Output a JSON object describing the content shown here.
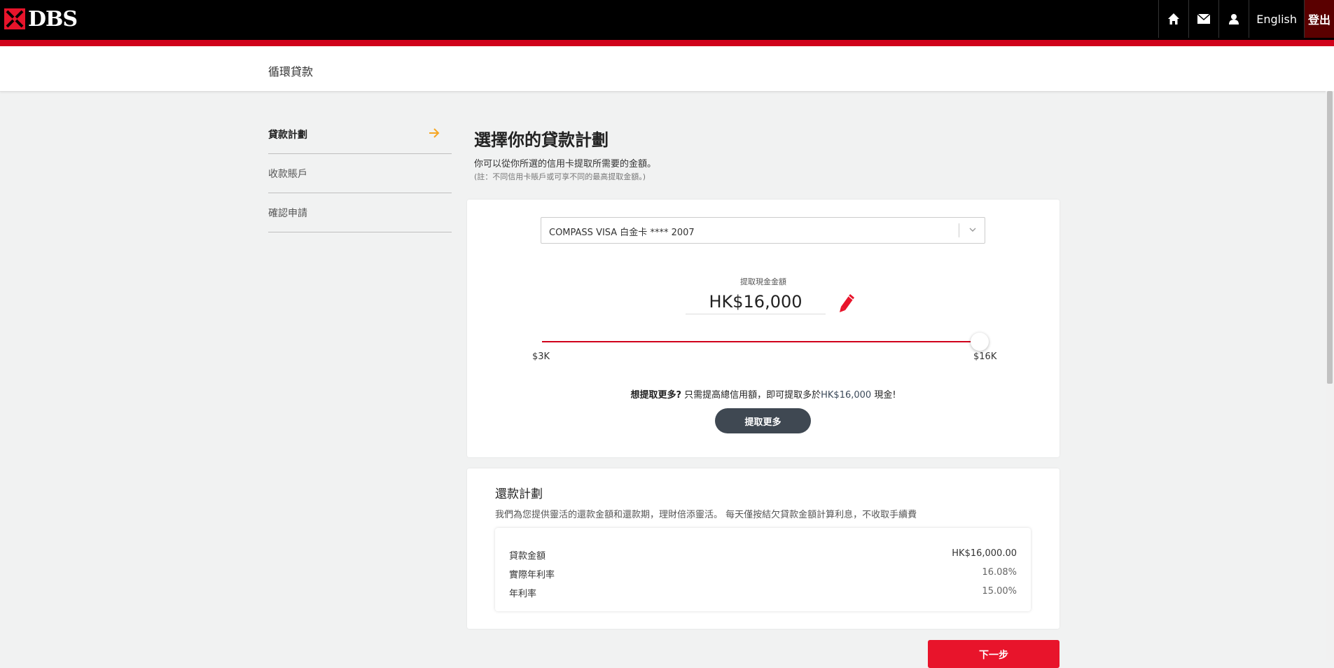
{
  "header": {
    "logo_text": "DBS",
    "lang_label": "English",
    "logout_label": "登出",
    "icons": [
      "home-icon",
      "mail-icon",
      "user-icon"
    ]
  },
  "subheader": {
    "title": "循環貸款"
  },
  "sidebar": {
    "items": [
      {
        "label": "貸款計劃",
        "active": true
      },
      {
        "label": "收款賬戶",
        "active": false
      },
      {
        "label": "確認申請",
        "active": false
      }
    ]
  },
  "main": {
    "title": "選擇你的貸款計劃",
    "desc": "你可以從你所選的信用卡提取所需要的金額。",
    "note": "(註：不同信用卡賬戶或可享不同的最高提取金額。)"
  },
  "loan_card": {
    "card_select_value": "COMPASS VISA 白金卡 **** 2007",
    "amount_label": "提取現金金額",
    "amount_value": "HK$16,000",
    "slider_min_label": "$3K",
    "slider_max_label": "$16K",
    "slider_min": 3000,
    "slider_max": 16000,
    "slider_value": 16000,
    "more_prefix": "想提取更多?",
    "more_middle": " 只需提高總信用額，即可提取多於",
    "more_amount": "HK$16,000",
    "more_suffix": " 現金!",
    "more_button": "提取更多"
  },
  "repayment": {
    "title": "還款計劃",
    "desc": "我們為您提供靈活的還款金額和還款期，理財倍添靈活。 每天僅按結欠貸款金額計算利息，不收取手續費",
    "rows": [
      {
        "label": "貸款金額",
        "value": "HK$16,000.00"
      },
      {
        "label": "實際年利率",
        "value": "16.08%"
      },
      {
        "label": "年利率",
        "value": "15.00%"
      }
    ]
  },
  "next_button": "下一步",
  "colors": {
    "accent_red": "#d0021b",
    "button_dark": "#3f4852",
    "arrow_orange": "#f5a623"
  }
}
